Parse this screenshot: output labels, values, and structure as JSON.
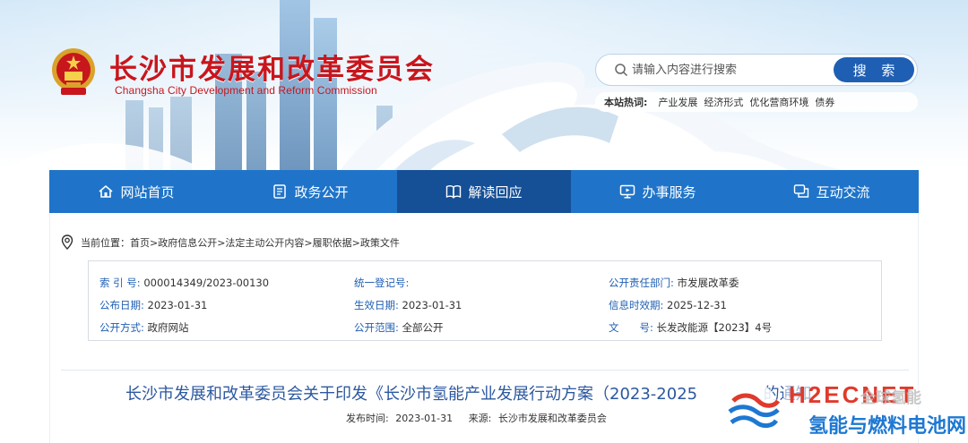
{
  "header": {
    "site_name": "长沙市发展和改革委员会",
    "site_name_en": "Changsha City Development and Reform Commission",
    "search": {
      "placeholder": "请输入内容进行搜索",
      "button_label": "搜 索"
    },
    "hot": {
      "label": "本站热词:",
      "terms": [
        "产业发展",
        "经济形式",
        "优化营商环境",
        "债券"
      ]
    }
  },
  "nav": {
    "items": [
      {
        "label": "网站首页",
        "icon": "home-icon"
      },
      {
        "label": "政务公开",
        "icon": "document-icon"
      },
      {
        "label": "解读回应",
        "icon": "book-icon",
        "active": true
      },
      {
        "label": "办事服务",
        "icon": "monitor-icon"
      },
      {
        "label": "互动交流",
        "icon": "chat-icon"
      }
    ]
  },
  "breadcrumb": {
    "prefix": "当前位置：",
    "path": "首页>政府信息公开>法定主动公开内容>履职依据>政策文件"
  },
  "meta": {
    "index_label": "索 引 号:",
    "index_value": "000014349/2023-00130",
    "unified_label": "统一登记号:",
    "unified_value": "",
    "dept_label": "公开责任部门:",
    "dept_value": "市发展改革委",
    "pub_date_label": "公布日期:",
    "pub_date_value": "2023-01-31",
    "effective_label": "生效日期:",
    "effective_value": "2023-01-31",
    "validity_label": "信息时效期:",
    "validity_value": "2025-12-31",
    "method_label": "公开方式:",
    "method_value": "政府网站",
    "scope_label": "公开范围:",
    "scope_value": "全部公开",
    "docno_label": "文　　号:",
    "docno_value": "长发改能源【2023】4号"
  },
  "article": {
    "title": "长沙市发展和改革委员会关于印发《长沙市氢能产业发展行动方案（2023-2025",
    "title_tail": "的通知",
    "publish_time_label": "发布时间:",
    "publish_time": "2023-01-31",
    "source_label": "来源:",
    "source": "长沙市发展和改革委员会"
  },
  "watermark": {
    "brand": "H2ECNET",
    "tagline": "氢能与燃料电池网",
    "faded_text": "全球氢能"
  },
  "colors": {
    "brand_red": "#c8161d",
    "nav_blue": "#1f74c9",
    "nav_active": "#154f96",
    "search_button": "#1f5fb3",
    "title_blue": "#2c58a0",
    "watermark_red": "#e03a2c",
    "watermark_blue": "#1e78d2"
  }
}
